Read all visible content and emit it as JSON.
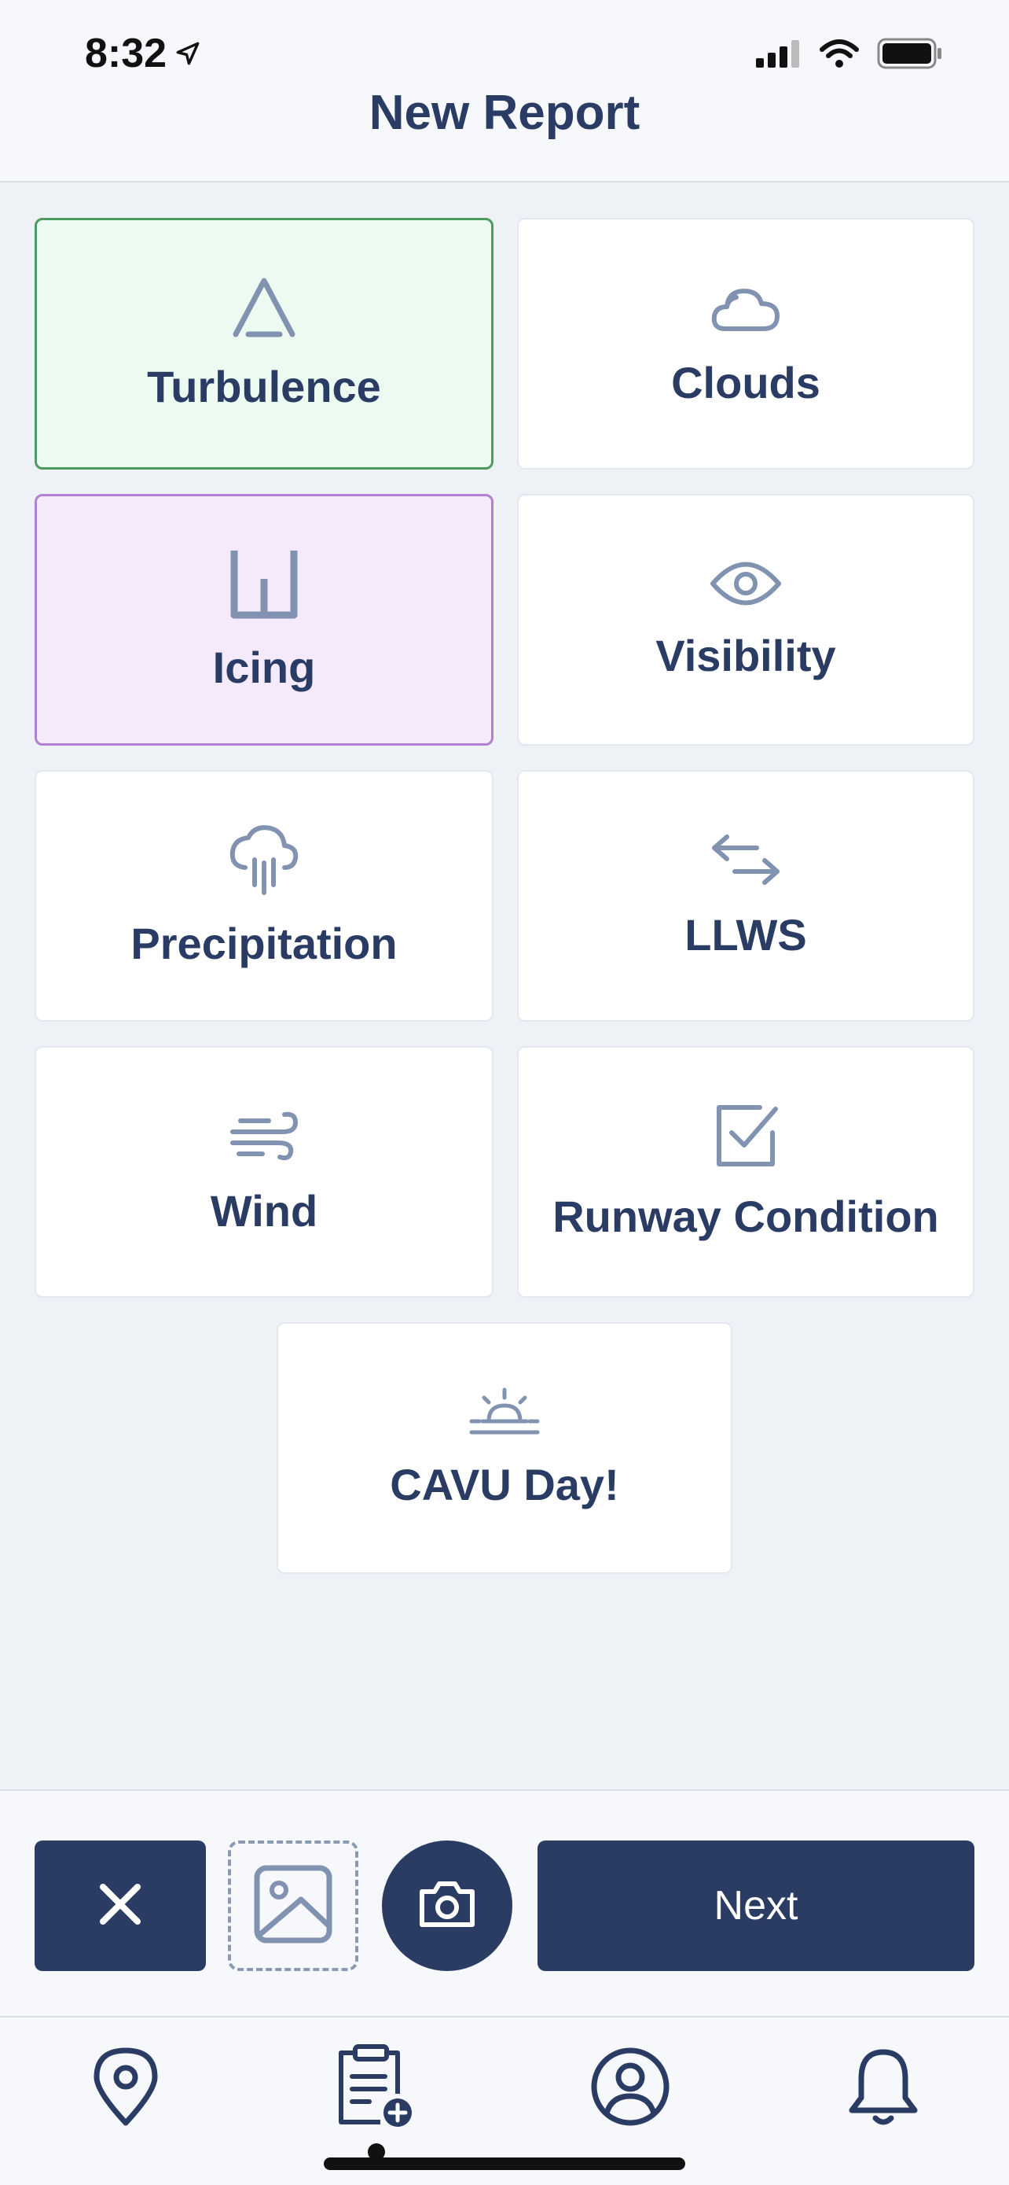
{
  "status_bar": {
    "time": "8:32"
  },
  "header": {
    "title": "New Report"
  },
  "categories": [
    {
      "label": "Turbulence",
      "icon": "turbulence-icon",
      "selected": true,
      "color": "#4f9a5e"
    },
    {
      "label": "Clouds",
      "icon": "cloud-icon",
      "selected": false
    },
    {
      "label": "Icing",
      "icon": "icing-icon",
      "selected": true,
      "color": "#b27ed6"
    },
    {
      "label": "Visibility",
      "icon": "eye-icon",
      "selected": false
    },
    {
      "label": "Precipitation",
      "icon": "rain-cloud-icon",
      "selected": false
    },
    {
      "label": "LLWS",
      "icon": "arrows-left-right-icon",
      "selected": false
    },
    {
      "label": "Wind",
      "icon": "wind-icon",
      "selected": false
    },
    {
      "label": "Runway Condition",
      "icon": "checkbox-icon",
      "selected": false
    },
    {
      "label": "CAVU Day!",
      "icon": "sunrise-icon",
      "selected": false
    }
  ],
  "actions": {
    "next_label": "Next"
  },
  "colors": {
    "primary": "#2a3c63",
    "background": "#eef1f5",
    "icon": "#8193b0"
  }
}
